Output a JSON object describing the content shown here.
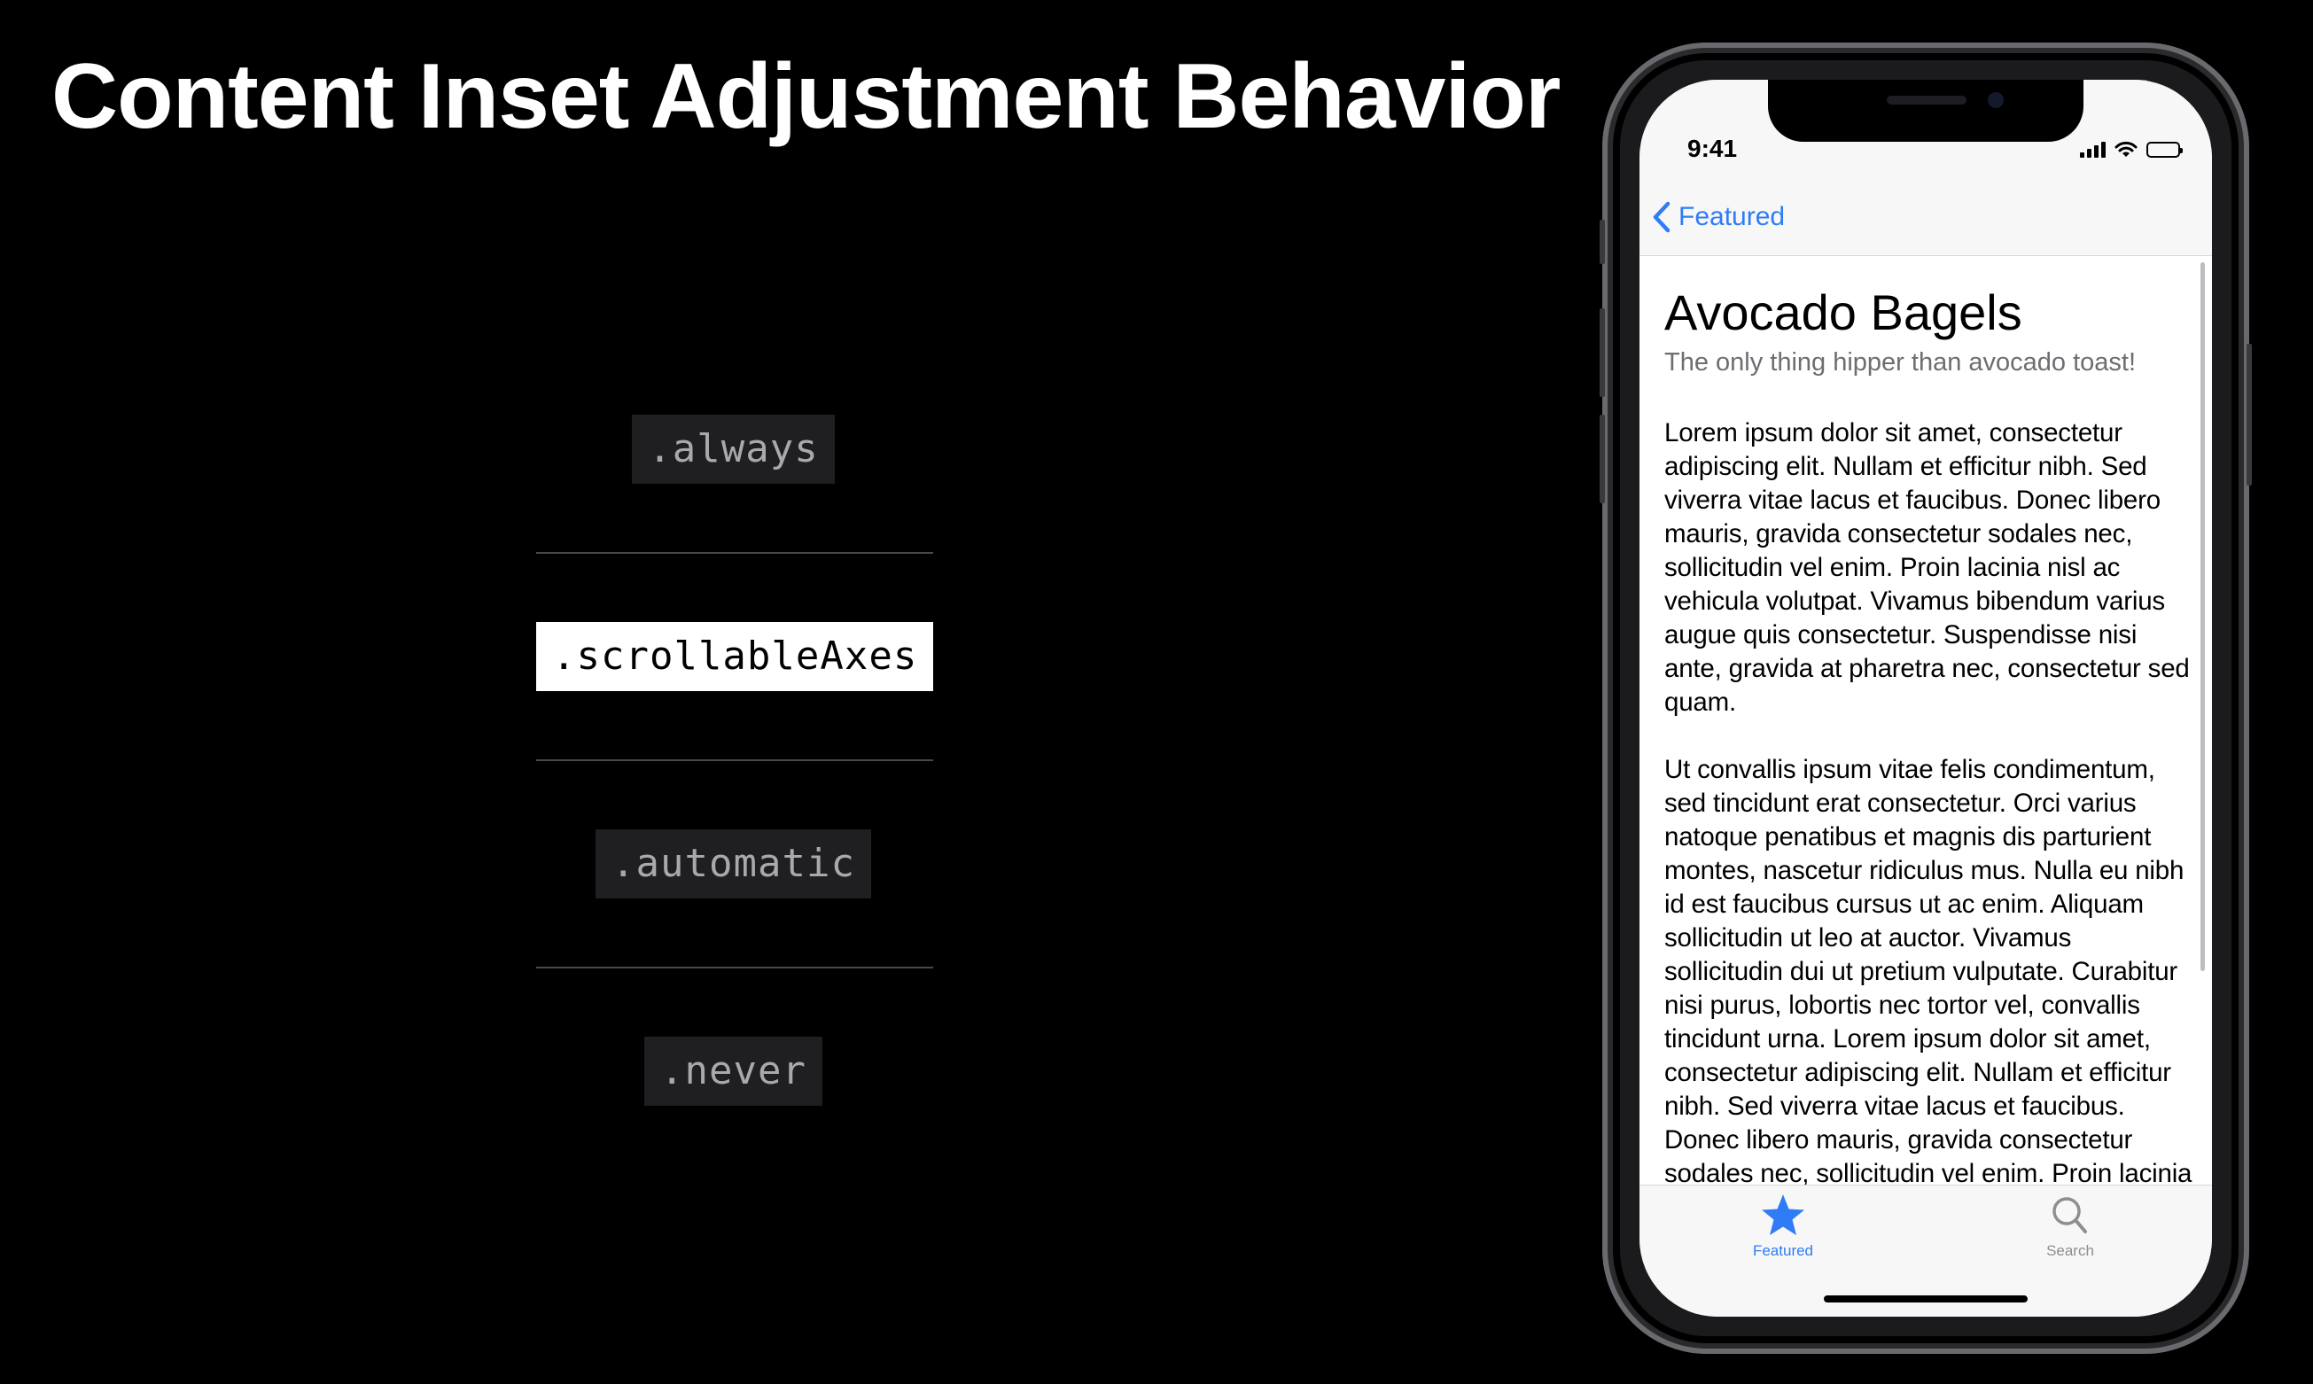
{
  "slide": {
    "title": "Content Inset Adjustment Behavior"
  },
  "options": [
    {
      "label": ".always",
      "selected": false
    },
    {
      "label": ".scrollableAxes",
      "selected": true
    },
    {
      "label": ".automatic",
      "selected": false
    },
    {
      "label": ".never",
      "selected": false
    }
  ],
  "phone": {
    "status": {
      "time": "9:41",
      "icons": [
        "signal-icon",
        "wifi-icon",
        "battery-icon"
      ]
    },
    "nav": {
      "back_label": "Featured",
      "back_icon": "chevron-left-icon"
    },
    "article": {
      "title": "Avocado Bagels",
      "subtitle": "The only thing hipper than avocado toast!",
      "paragraph_1": "Lorem ipsum dolor sit amet, consectetur adipiscing elit. Nullam et efficitur nibh. Sed viverra vitae lacus et faucibus. Donec libero mauris, gravida consectetur sodales nec, sollicitudin vel enim. Proin lacinia nisl ac vehicula volutpat. Vivamus bibendum varius augue quis consectetur. Suspendisse nisi ante, gravida at pharetra nec, consectetur sed quam.",
      "paragraph_2": "Ut convallis ipsum vitae felis condimentum, sed tincidunt erat consectetur. Orci varius natoque penatibus et magnis dis parturient montes, nascetur ridiculus mus. Nulla eu nibh id est faucibus cursus ut ac enim. Aliquam sollicitudin ut leo at auctor. Vivamus sollicitudin dui ut pretium vulputate. Curabitur nisi purus, lobortis nec tortor vel, convallis tincidunt urna. Lorem ipsum dolor sit amet, consectetur adipiscing elit. Nullam et efficitur nibh. Sed viverra vitae lacus et faucibus. Donec libero mauris, gravida consectetur sodales nec, sollicitudin vel enim. Proin lacinia nisl ac vehicula volutpat."
    },
    "tabs": [
      {
        "label": "Featured",
        "icon": "star-icon",
        "active": true
      },
      {
        "label": "Search",
        "icon": "magnifier-icon",
        "active": false
      }
    ]
  },
  "colors": {
    "background": "#000000",
    "accent": "#2f7cf6",
    "chip_background": "#1f1f21",
    "chip_text": "#a9a9ad",
    "selected_chip": "#ffffff",
    "inactive_tab": "#8e8e93"
  }
}
